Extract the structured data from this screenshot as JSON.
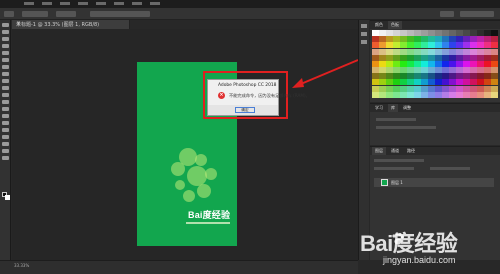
{
  "app": {
    "name": "Photoshop"
  },
  "document_tab": {
    "title": "未标题-1 @ 33.3% (图层 1, RGB/8)",
    "close": "×"
  },
  "dialog": {
    "title": "Adobe Photoshop CC 2018",
    "message": "不能完成命令，因为没有足够内存 (RAM)。",
    "ok_label": "确定",
    "icon": "error-icon"
  },
  "poster": {
    "logo_text": "Bai度经验",
    "color": "#12a64e"
  },
  "panels": {
    "color_tabs": [
      "颜色",
      "色板"
    ],
    "library_tabs": [
      "学习",
      "库",
      "调整"
    ],
    "layers_tabs": [
      "图层",
      "通道",
      "路径"
    ],
    "layer_name": "图层 1"
  },
  "status": {
    "zoom": "33.33%"
  },
  "watermark": {
    "brand": "Bai度经验",
    "url": "jingyan.baidu.com"
  },
  "colors": {
    "accent_red": "#e02020",
    "poster_green": "#12a64e"
  }
}
